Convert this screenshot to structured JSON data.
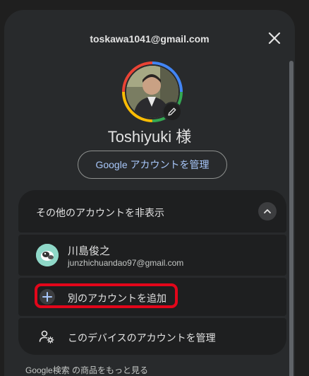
{
  "header": {
    "email": "toskawa1041@gmail.com",
    "close_icon": "close-icon"
  },
  "profile": {
    "name": "Toshiyuki 様",
    "edit_icon": "pencil-icon",
    "manage_label": "Google アカウントを管理"
  },
  "other_accounts": {
    "toggle_label": "その他のアカウントを非表示",
    "toggle_icon": "chevron-up-icon",
    "accounts": [
      {
        "name": "川島俊之",
        "email": "junzhichuandao97@gmail.com"
      }
    ],
    "add_label": "別のアカウントを追加",
    "add_icon": "plus-icon",
    "manage_devices_label": "このデバイスのアカウントを管理",
    "manage_devices_icon": "manage-accounts-icon"
  },
  "footer": {
    "more_products": "Google検索 の商品をもっと見る"
  },
  "colors": {
    "panel": "#282a2c",
    "card": "#1e1f20",
    "accent_link": "#a8c7fa",
    "highlight": "#e2061a",
    "ring_red": "#ea4335",
    "ring_yellow": "#fbbc04",
    "ring_green": "#34a853",
    "ring_blue": "#4285f4"
  }
}
